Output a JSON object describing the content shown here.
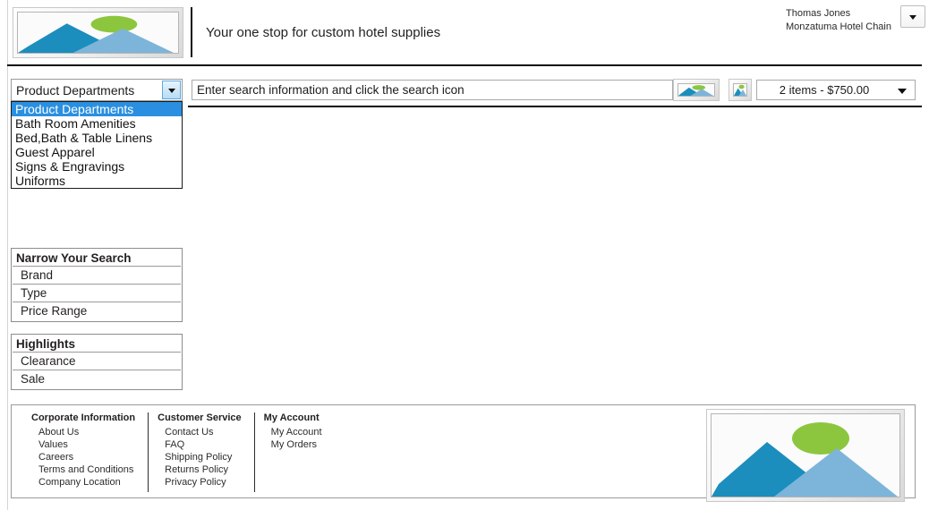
{
  "header": {
    "logo_icon": "image-placeholder-icon",
    "tagline": "Your one stop for custom hotel supplies",
    "user_name": "Thomas Jones",
    "user_company": "Monzatuma Hotel Chain",
    "user_menu_icon": "chevron-down-icon"
  },
  "search_bar": {
    "department_select": {
      "selected": "Product Departments",
      "arrow_icon": "chevron-down-icon",
      "expanded": true,
      "options": [
        "Product Departments",
        "Bath Room Amenities",
        "Bed,Bath & Table Linens",
        "Guest Apparel",
        "Signs & Engravings",
        "Uniforms"
      ],
      "highlighted_index": 0
    },
    "search_placeholder": "Enter search information and click the search icon",
    "search_value": "",
    "search_button_icon": "image-placeholder-icon",
    "secondary_button_icon": "image-placeholder-icon",
    "cart": {
      "label": "2 items - $750.00",
      "arrow_icon": "chevron-down-icon"
    }
  },
  "sidebar": {
    "panels": [
      {
        "title": "Narrow Your Search",
        "items": [
          "Brand",
          "Type",
          "Price Range"
        ]
      },
      {
        "title": "Highlights",
        "items": [
          "Clearance",
          "Sale"
        ]
      }
    ]
  },
  "footer": {
    "columns": [
      {
        "title": "Corporate Information",
        "links": [
          "About Us",
          "Values",
          "Careers",
          "Terms and Conditions",
          "Company Location"
        ]
      },
      {
        "title": "Customer Service",
        "links": [
          "Contact Us",
          "FAQ",
          "Shipping Policy",
          "Returns Policy",
          "Privacy Policy"
        ]
      },
      {
        "title": "My Account",
        "links": [
          "My Account",
          "My Orders"
        ]
      }
    ],
    "logo_icon": "image-placeholder-icon"
  },
  "colors": {
    "highlight_blue": "#2a8fe0",
    "image_mountain_dark": "#1b8ebd",
    "image_mountain_light": "#7db4da",
    "image_sun_green": "#8cc63e",
    "rule_black": "#0a0a0a"
  }
}
